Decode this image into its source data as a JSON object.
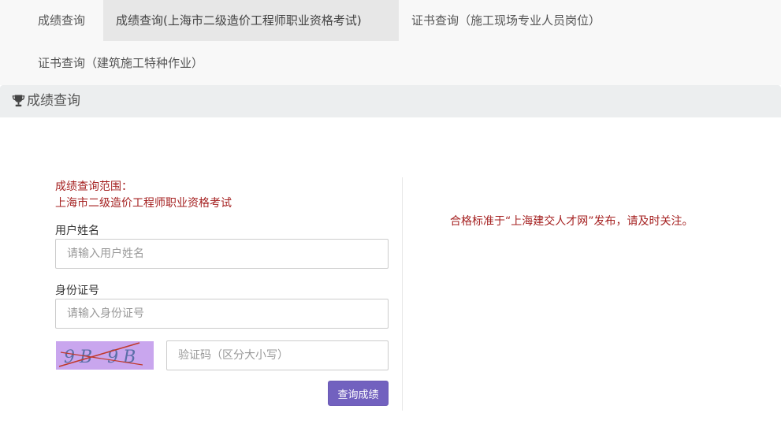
{
  "nav": {
    "tabs": [
      {
        "label": "成绩查询",
        "active": false
      },
      {
        "label": "成绩查询(上海市二级造价工程师职业资格考试)",
        "active": true
      },
      {
        "label": "证书查询（施工现场专业人员岗位）",
        "active": false
      },
      {
        "label": "证书查询（建筑施工特种作业）",
        "active": false
      }
    ]
  },
  "panel": {
    "icon": "trophy-icon",
    "title": "成绩查询"
  },
  "form": {
    "scope_line1": "成绩查询范围：",
    "scope_line2": "上海市二级造价工程师职业资格考试",
    "username_label": "用户姓名",
    "username_placeholder": "请输入用户姓名",
    "username_value": "",
    "idcard_label": "身份证号",
    "idcard_placeholder": "请输入身份证号",
    "idcard_value": "",
    "captcha_image_text": "9B 9B",
    "captcha_placeholder": "验证码（区分大小写）",
    "captcha_value": "",
    "submit_label": "查询成绩"
  },
  "notice": {
    "text": "合格标准于“上海建交人才网”发布，请及时关注。"
  },
  "colors": {
    "accent": "#7261bf",
    "notice_red": "#a52121",
    "active_tab_bg": "#e7e7e7",
    "nav_bg": "#f8f8f8",
    "heading_bg": "#eceeef",
    "captcha_bg": "#c9a6ee"
  }
}
